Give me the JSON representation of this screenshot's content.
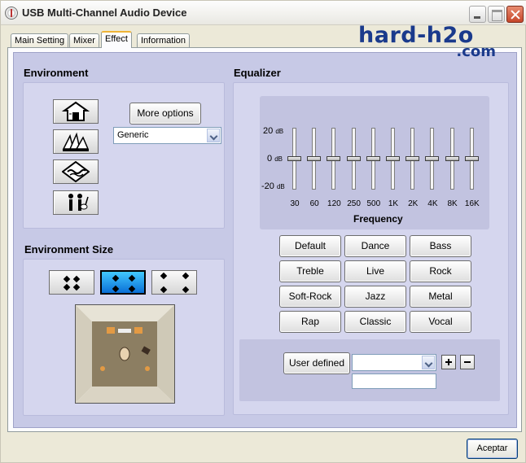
{
  "window": {
    "title": "USB Multi-Channel Audio Device"
  },
  "tabs": [
    {
      "label": "Main Setting"
    },
    {
      "label": "Mixer"
    },
    {
      "label": "Effect",
      "active": true
    },
    {
      "label": "Information"
    }
  ],
  "watermark": {
    "line1": "hard-h2o",
    "line2": ".com"
  },
  "environment": {
    "title": "Environment",
    "icons": [
      "hall-icon",
      "opera-house-icon",
      "underwater-icon",
      "music-room-icon"
    ],
    "more_options_label": "More options",
    "select_value": "Generic"
  },
  "environment_size": {
    "title": "Environment Size",
    "options": [
      "small-room-icon",
      "medium-room-icon",
      "large-room-icon"
    ],
    "selected_index": 1
  },
  "equalizer": {
    "title": "Equalizer",
    "db_labels": {
      "top": "20",
      "mid": "0",
      "bottom": "-20",
      "unit": "dB"
    },
    "frequency_label": "Frequency",
    "bands": [
      {
        "freq": "30",
        "value": 0
      },
      {
        "freq": "60",
        "value": 0
      },
      {
        "freq": "120",
        "value": 0
      },
      {
        "freq": "250",
        "value": 0
      },
      {
        "freq": "500",
        "value": 0
      },
      {
        "freq": "1K",
        "value": 0
      },
      {
        "freq": "2K",
        "value": 0
      },
      {
        "freq": "4K",
        "value": 0
      },
      {
        "freq": "8K",
        "value": 0
      },
      {
        "freq": "16K",
        "value": 0
      }
    ],
    "presets": [
      "Default",
      "Dance",
      "Bass",
      "Treble",
      "Live",
      "Rock",
      "Soft-Rock",
      "Jazz",
      "Metal",
      "Rap",
      "Classic",
      "Vocal"
    ],
    "user_defined_label": "User defined",
    "user_select_value": "",
    "user_name_value": ""
  },
  "footer": {
    "accept_label": "Aceptar"
  },
  "colors": {
    "panel_bg": "#c7c9e6",
    "accent_blue": "#0a6fd6",
    "logo": "#1a3a8c"
  }
}
